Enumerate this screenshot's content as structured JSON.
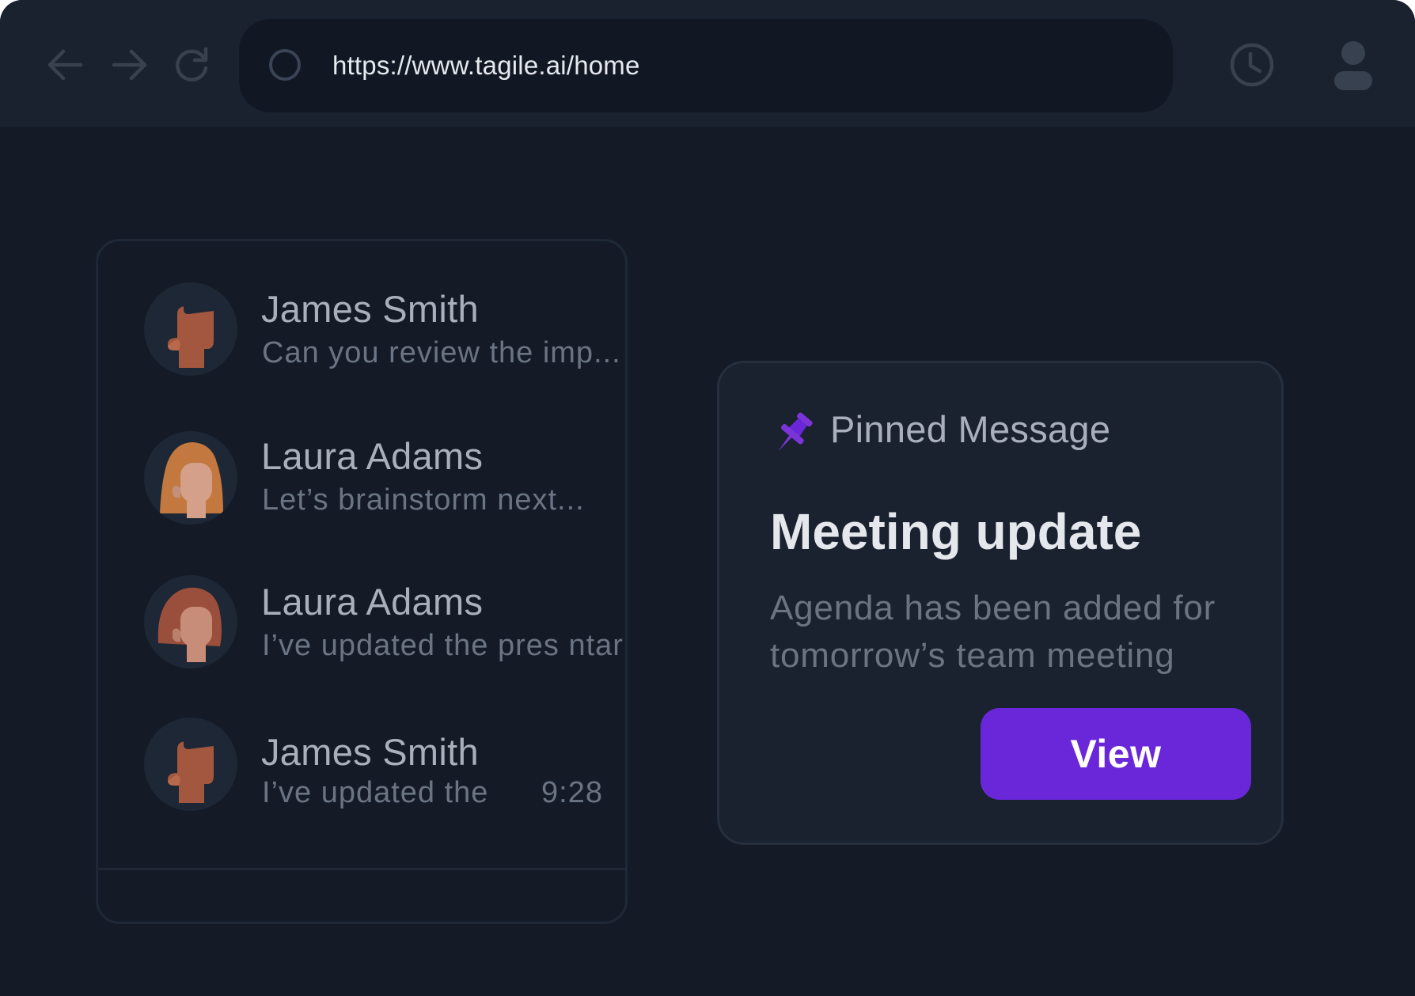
{
  "browser": {
    "url": "https://www.tagile.ai/home",
    "icons": {
      "back": "back-arrow-icon",
      "forward": "forward-arrow-icon",
      "reload": "reload-icon",
      "site": "site-info-icon",
      "history": "history-clock-icon",
      "profile": "profile-icon"
    }
  },
  "chats": [
    {
      "name": "James Smith",
      "preview": "Can you review the imp...",
      "time": "",
      "avatar": "male-avatar"
    },
    {
      "name": "Laura Adams",
      "preview": "Let’s brainstorm  next...",
      "time": "",
      "avatar": "female-avatar-light"
    },
    {
      "name": "Laura Adams",
      "preview": "I’ve updated the pres ntar",
      "time": "",
      "avatar": "female-avatar-dark"
    },
    {
      "name": "James Smith",
      "preview": "I’ve updated the",
      "time": "9:28",
      "avatar": "male-avatar"
    }
  ],
  "pinned": {
    "label": "Pinned Message",
    "title": "Meeting update",
    "body": "Agenda has been added for tomorrow’s team meeting",
    "button_label": "View",
    "icon": "pin-icon"
  },
  "colors": {
    "background": "#141b27",
    "chrome": "#1a2230",
    "accent": "#6a27d9",
    "pin": "#7a34d8"
  }
}
